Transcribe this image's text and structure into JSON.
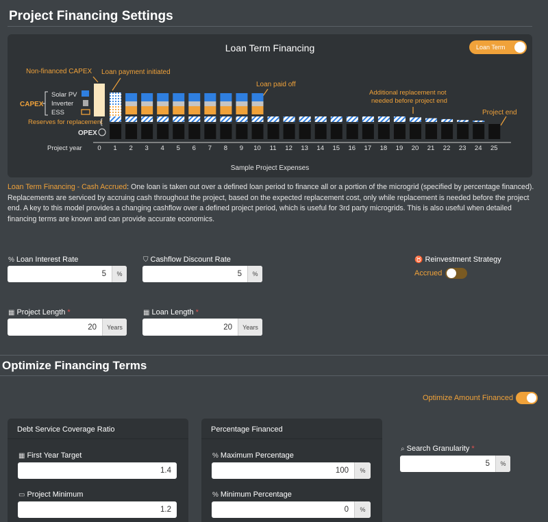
{
  "page": {
    "title": "Project Financing Settings",
    "optimize_title": "Optimize Financing Terms"
  },
  "diagram": {
    "title": "Loan Term Financing",
    "toggle_label": "Loan Term",
    "caption": "Sample Project Expenses",
    "annotations": {
      "non_financed": "Non-financed CAPEX",
      "loan_initiated": "Loan payment initiated",
      "loan_paid_off": "Loan paid off",
      "additional_line1": "Additional replacement not",
      "additional_line2": "needed before project end",
      "project_end": "Project end",
      "reserves": "Reserves for replacement",
      "capex": "CAPEX",
      "opex": "OPEX",
      "solar_pv": "Solar PV",
      "inverter": "Inverter",
      "ess": "ESS",
      "project_year": "Project year"
    },
    "years": [
      "0",
      "1",
      "2",
      "3",
      "4",
      "5",
      "6",
      "7",
      "8",
      "9",
      "10",
      "11",
      "12",
      "13",
      "14",
      "15",
      "16",
      "17",
      "18",
      "19",
      "20",
      "21",
      "22",
      "23",
      "24",
      "25"
    ],
    "colors": {
      "orange": "#f0a23a",
      "blue": "#2f7fe0",
      "gray": "#c4c4c4",
      "cream": "#fbe7bf"
    }
  },
  "description": {
    "heading": "Loan Term Financing - Cash Accrued",
    "body": ": One loan is taken out over a defined loan period to finance all or a portion of the microgrid (specified by percentage financed). Replacements are serviced by accruing cash throughout the project, based on the expected replacement cost, only while replacement is needed before the project end. A key to this model provides a changing cashflow over a defined project period, which is useful for 3rd party microgrids. This is also useful when detailed financing terms are known and can provide accurate economics."
  },
  "fields": {
    "loan_interest_rate": {
      "label": "Loan Interest Rate",
      "value": "5",
      "unit": "%"
    },
    "cashflow_discount_rate": {
      "label": "Cashflow Discount Rate",
      "value": "5",
      "unit": "%"
    },
    "reinvestment_strategy": {
      "label": "Reinvestment Strategy",
      "toggle_label": "Accrued"
    },
    "project_length": {
      "label": "Project Length",
      "value": "20",
      "unit": "Years",
      "required": "*"
    },
    "loan_length": {
      "label": "Loan Length",
      "value": "20",
      "unit": "Years",
      "required": "*"
    }
  },
  "optimize": {
    "toggle_label": "Optimize Amount Financed",
    "dscr": {
      "title": "Debt Service Coverage Ratio",
      "first_year_label": "First Year Target",
      "first_year_value": "1.4",
      "project_min_label": "Project Minimum",
      "project_min_value": "1.2"
    },
    "pct": {
      "title": "Percentage Financed",
      "max_label": "Maximum Percentage",
      "max_value": "100",
      "max_unit": "%",
      "min_label": "Minimum Percentage",
      "min_value": "0",
      "min_unit": "%"
    },
    "granularity": {
      "label": "Search Granularity",
      "value": "5",
      "unit": "%",
      "required": "*"
    }
  }
}
